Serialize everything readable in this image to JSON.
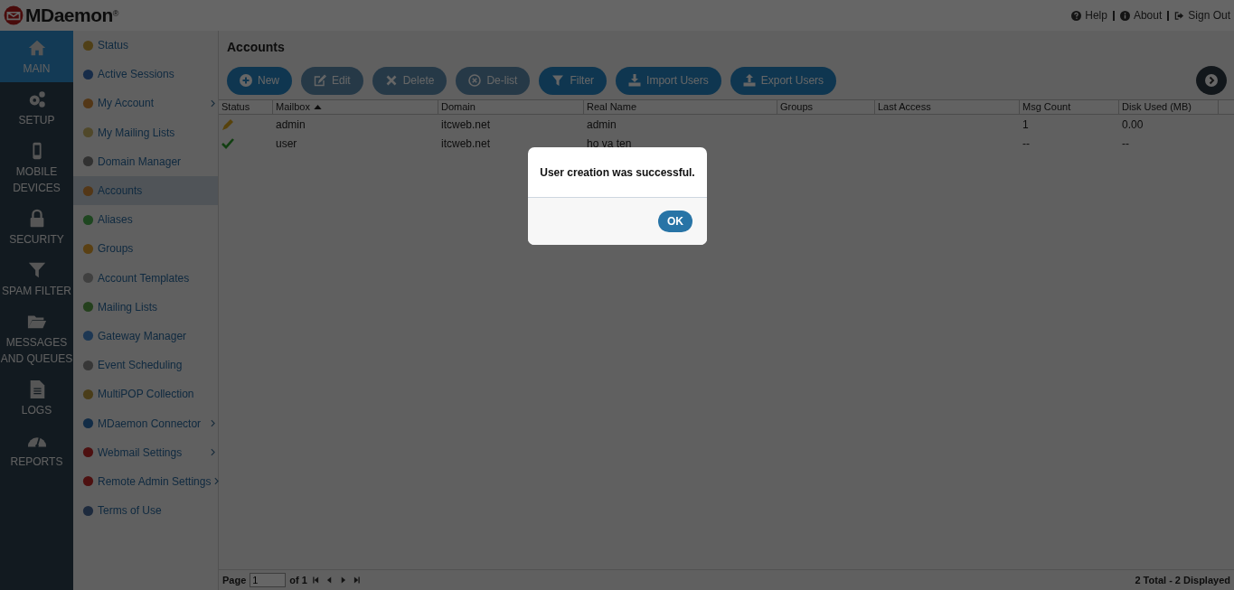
{
  "header": {
    "logo": "MDaemon",
    "logo_mark": "®",
    "links": [
      {
        "label": "Help",
        "kind": "question"
      },
      {
        "label": "About",
        "kind": "info"
      },
      {
        "label": "Sign Out",
        "kind": "signout"
      }
    ]
  },
  "nav": [
    {
      "label": "MAIN",
      "kind": "home",
      "selected": true
    },
    {
      "label": "SETUP",
      "kind": "gears",
      "selected": false
    },
    {
      "label": "MOBILE DEVICES",
      "kind": "phone",
      "selected": false
    },
    {
      "label": "SECURITY",
      "kind": "lock",
      "selected": false
    },
    {
      "label": "SPAM FILTER",
      "kind": "funnel",
      "selected": false
    },
    {
      "label": "MESSAGES AND QUEUES",
      "kind": "folder",
      "selected": false
    },
    {
      "label": "LOGS",
      "kind": "document",
      "selected": false
    },
    {
      "label": "REPORTS",
      "kind": "gauge",
      "selected": false
    }
  ],
  "submenu": [
    {
      "label": "Status",
      "selected": false,
      "has_submenu": false
    },
    {
      "label": "Active Sessions",
      "selected": false,
      "has_submenu": false
    },
    {
      "label": "My Account",
      "selected": false,
      "has_submenu": true
    },
    {
      "label": "My Mailing Lists",
      "selected": false,
      "has_submenu": false
    },
    {
      "label": "Domain Manager",
      "selected": false,
      "has_submenu": false
    },
    {
      "label": "Accounts",
      "selected": true,
      "has_submenu": false
    },
    {
      "label": "Aliases",
      "selected": false,
      "has_submenu": false
    },
    {
      "label": "Groups",
      "selected": false,
      "has_submenu": false
    },
    {
      "label": "Account Templates",
      "selected": false,
      "has_submenu": false
    },
    {
      "label": "Mailing Lists",
      "selected": false,
      "has_submenu": false
    },
    {
      "label": "Gateway Manager",
      "selected": false,
      "has_submenu": false
    },
    {
      "label": "Event Scheduling",
      "selected": false,
      "has_submenu": false
    },
    {
      "label": "MultiPOP Collection",
      "selected": false,
      "has_submenu": false
    },
    {
      "label": "MDaemon Connector",
      "selected": false,
      "has_submenu": true
    },
    {
      "label": "Webmail Settings",
      "selected": false,
      "has_submenu": true
    },
    {
      "label": "Remote Admin Settings",
      "selected": false,
      "has_submenu": true
    },
    {
      "label": "Terms of Use",
      "selected": false,
      "has_submenu": false
    }
  ],
  "page_title": "Accounts",
  "toolbar": [
    {
      "label": "New",
      "kind": "plus",
      "disabled": false
    },
    {
      "label": "Edit",
      "kind": "edit",
      "disabled": true
    },
    {
      "label": "Delete",
      "kind": "x",
      "disabled": true
    },
    {
      "label": "De-list",
      "kind": "xcircle",
      "disabled": true
    },
    {
      "label": "Filter",
      "kind": "funnel",
      "disabled": false
    },
    {
      "label": "Import Users",
      "kind": "download",
      "disabled": false
    },
    {
      "label": "Export Users",
      "kind": "upload",
      "disabled": false
    }
  ],
  "table": {
    "columns": [
      {
        "label": "Status",
        "sorted": false
      },
      {
        "label": "Mailbox",
        "sorted": true
      },
      {
        "label": "Domain",
        "sorted": false
      },
      {
        "label": "Real Name",
        "sorted": false
      },
      {
        "label": "Groups",
        "sorted": false
      },
      {
        "label": "Last Access",
        "sorted": false
      },
      {
        "label": "Msg Count",
        "sorted": false
      },
      {
        "label": "Disk Used (MB)",
        "sorted": false
      }
    ],
    "rows": [
      {
        "kind": "admin",
        "cells": [
          "",
          "admin",
          "itcweb.net",
          "admin",
          "",
          "",
          "1",
          "0.00"
        ]
      },
      {
        "kind": "active",
        "cells": [
          "",
          "user",
          "itcweb.net",
          "ho va ten",
          "",
          "",
          "--",
          "--"
        ]
      }
    ]
  },
  "pager": {
    "page_label": "Page",
    "page": "1",
    "of": "of 1",
    "summary": "2 Total - 2 Displayed"
  },
  "dialog": {
    "message": "User creation was successful.",
    "button": "OK"
  }
}
